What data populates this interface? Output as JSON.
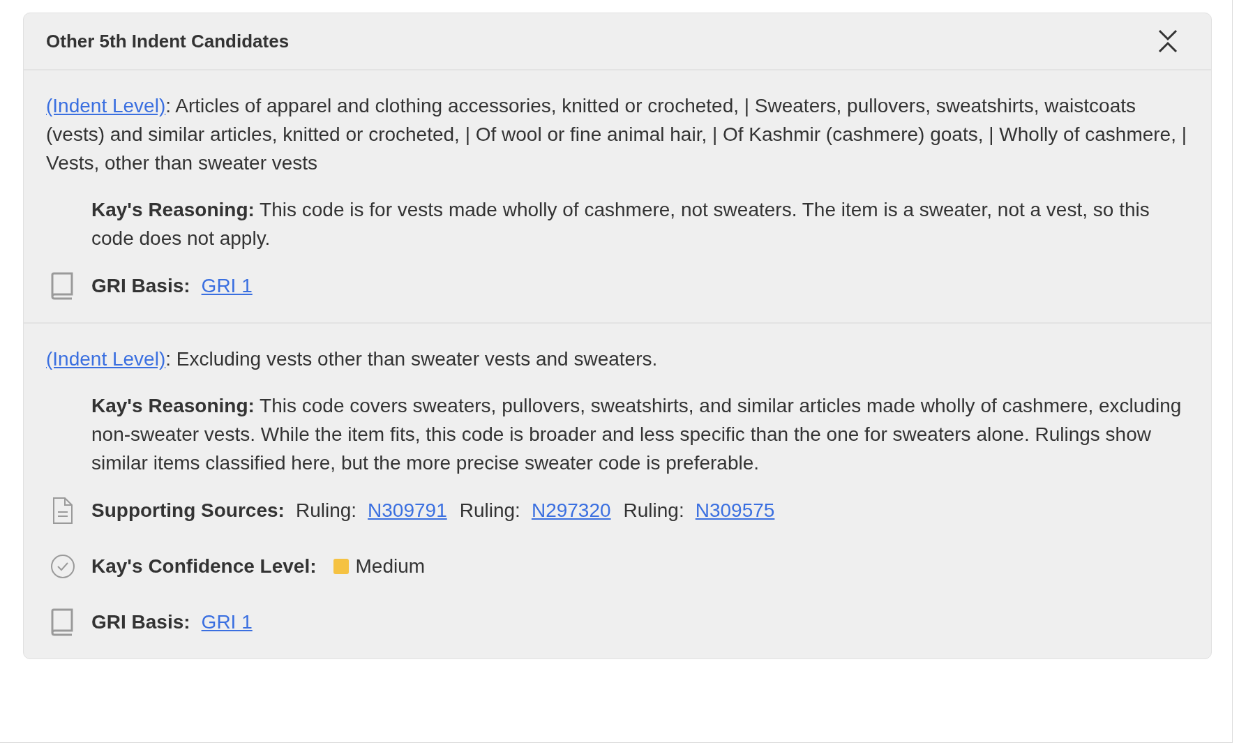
{
  "panel": {
    "title": "Other 5th Indent Candidates",
    "expanded": true
  },
  "candidates": [
    {
      "link": "(Indent Level)",
      "description": ": Articles of apparel and clothing accessories, knitted or crocheted, | Sweaters, pullovers, sweatshirts, waistcoats (vests) and similar articles, knitted or crocheted, | Of wool or fine animal hair, | Of Kashmir (cashmere) goats, | Wholly of cashmere, | Vests, other than sweater vests",
      "reasoning": "**Kay's Reasoning:** This code is for vests made wholly of cashmere, not sweaters. The item is a sweater, not a vest, so this code does not apply.",
      "details": [
        {
          "kind": "gri",
          "label": "GRI Basis:",
          "link": "GRI 1"
        }
      ]
    },
    {
      "link": "(Indent Level)",
      "description": ": Excluding vests other than sweater vests and sweaters.",
      "reasoning": "**Kay's Reasoning:** This code covers sweaters, pullovers, sweatshirts, and similar articles made wholly of cashmere, excluding non-sweater vests. While the item fits, this code is broader and less specific than the one for sweaters alone. Rulings show similar items classified here, but the more precise sweater code is preferable.",
      "details": [
        {
          "kind": "sources",
          "label": "Supporting Sources:",
          "sources": [
            {
              "prefix": "Ruling:",
              "link": "N309791"
            },
            {
              "prefix": "Ruling:",
              "link": "N297320"
            },
            {
              "prefix": "Ruling:",
              "link": "N309575"
            }
          ]
        },
        {
          "kind": "confidence",
          "label": "Kay's Confidence Level:",
          "value": "Medium",
          "color": "#f5c242"
        },
        {
          "kind": "gri",
          "label": "GRI Basis:",
          "link": "GRI 1"
        }
      ]
    }
  ]
}
